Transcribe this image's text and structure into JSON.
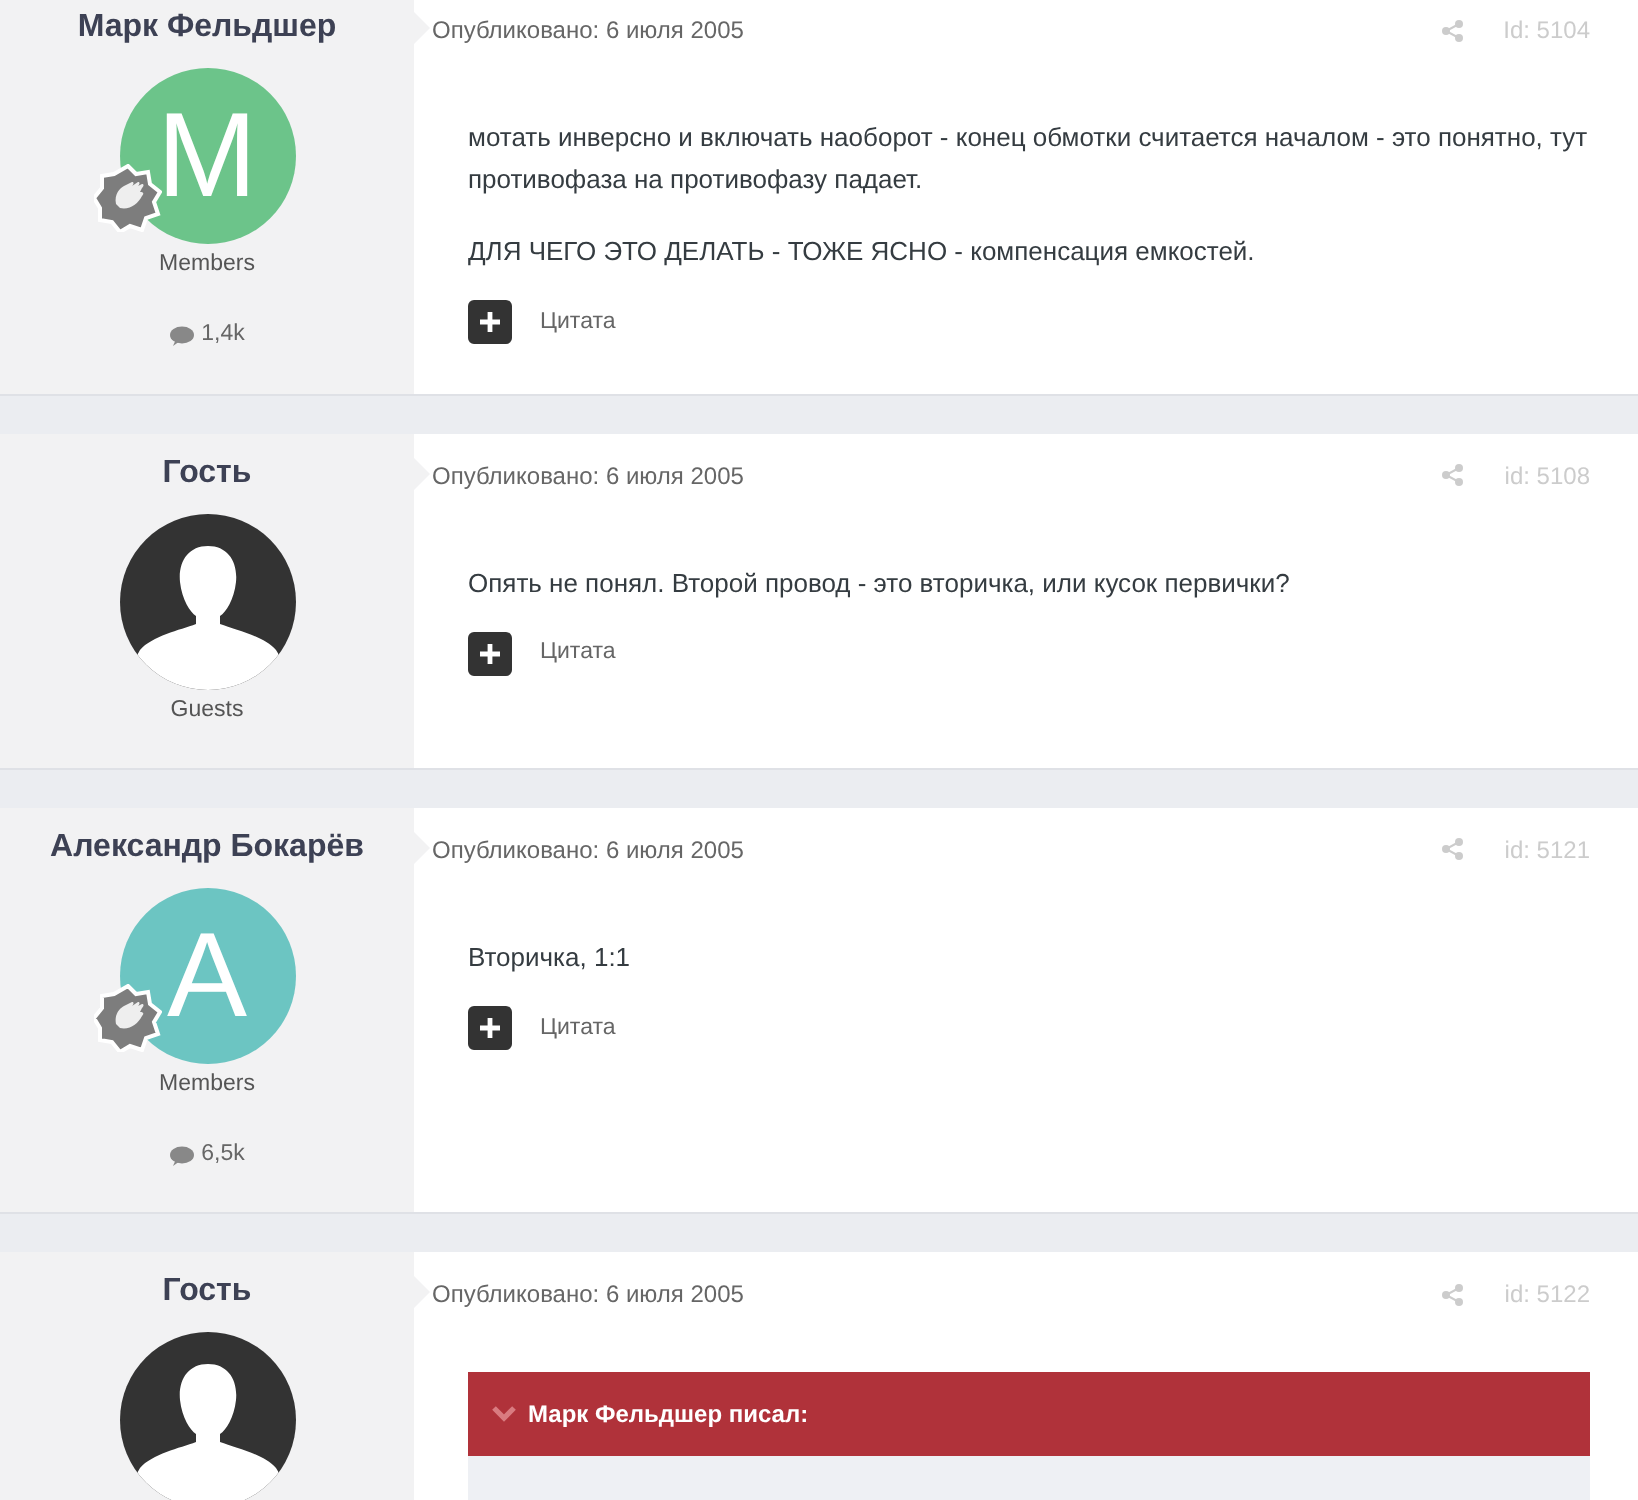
{
  "posts": [
    {
      "author": "Марк Фельдшер",
      "avatar": {
        "kind": "letter",
        "letter": "M",
        "color": "#6cc48a"
      },
      "badge": true,
      "group": "Members",
      "post_count": "1,4k",
      "date": "Опубликовано: 6 июля 2005",
      "id": "Id: 5104",
      "paragraphs": [
        "мотать инверсно и включать наоборот - конец обмотки считается началом - это понятно, тут противофаза на противофазу падает.",
        "ДЛЯ ЧЕГО ЭТО ДЕЛАТЬ - ТОЖЕ ЯСНО - компенсация емкостей."
      ],
      "quote_label": "Цитата"
    },
    {
      "author": "Гость",
      "avatar": {
        "kind": "guest"
      },
      "badge": false,
      "group": "Guests",
      "date": "Опубликовано: 6 июля 2005",
      "id": "id: 5108",
      "paragraphs": [
        "Опять не понял. Второй провод - это вторичка, или кусок первички?"
      ],
      "quote_label": "Цитата"
    },
    {
      "author": "Александр Бокарёв",
      "avatar": {
        "kind": "letter",
        "letter": "A",
        "color": "#6cc5c2"
      },
      "badge": true,
      "group": "Members",
      "post_count": "6,5k",
      "date": "Опубликовано: 6 июля 2005",
      "id": "id: 5121",
      "paragraphs": [
        "Вторичка, 1:1"
      ],
      "quote_label": "Цитата"
    },
    {
      "author": "Гость",
      "avatar": {
        "kind": "guest"
      },
      "badge": false,
      "date": "Опубликовано: 6 июля 2005",
      "id": "id: 5122",
      "quote": {
        "title": "Марк Фельдшер писал:"
      }
    }
  ]
}
